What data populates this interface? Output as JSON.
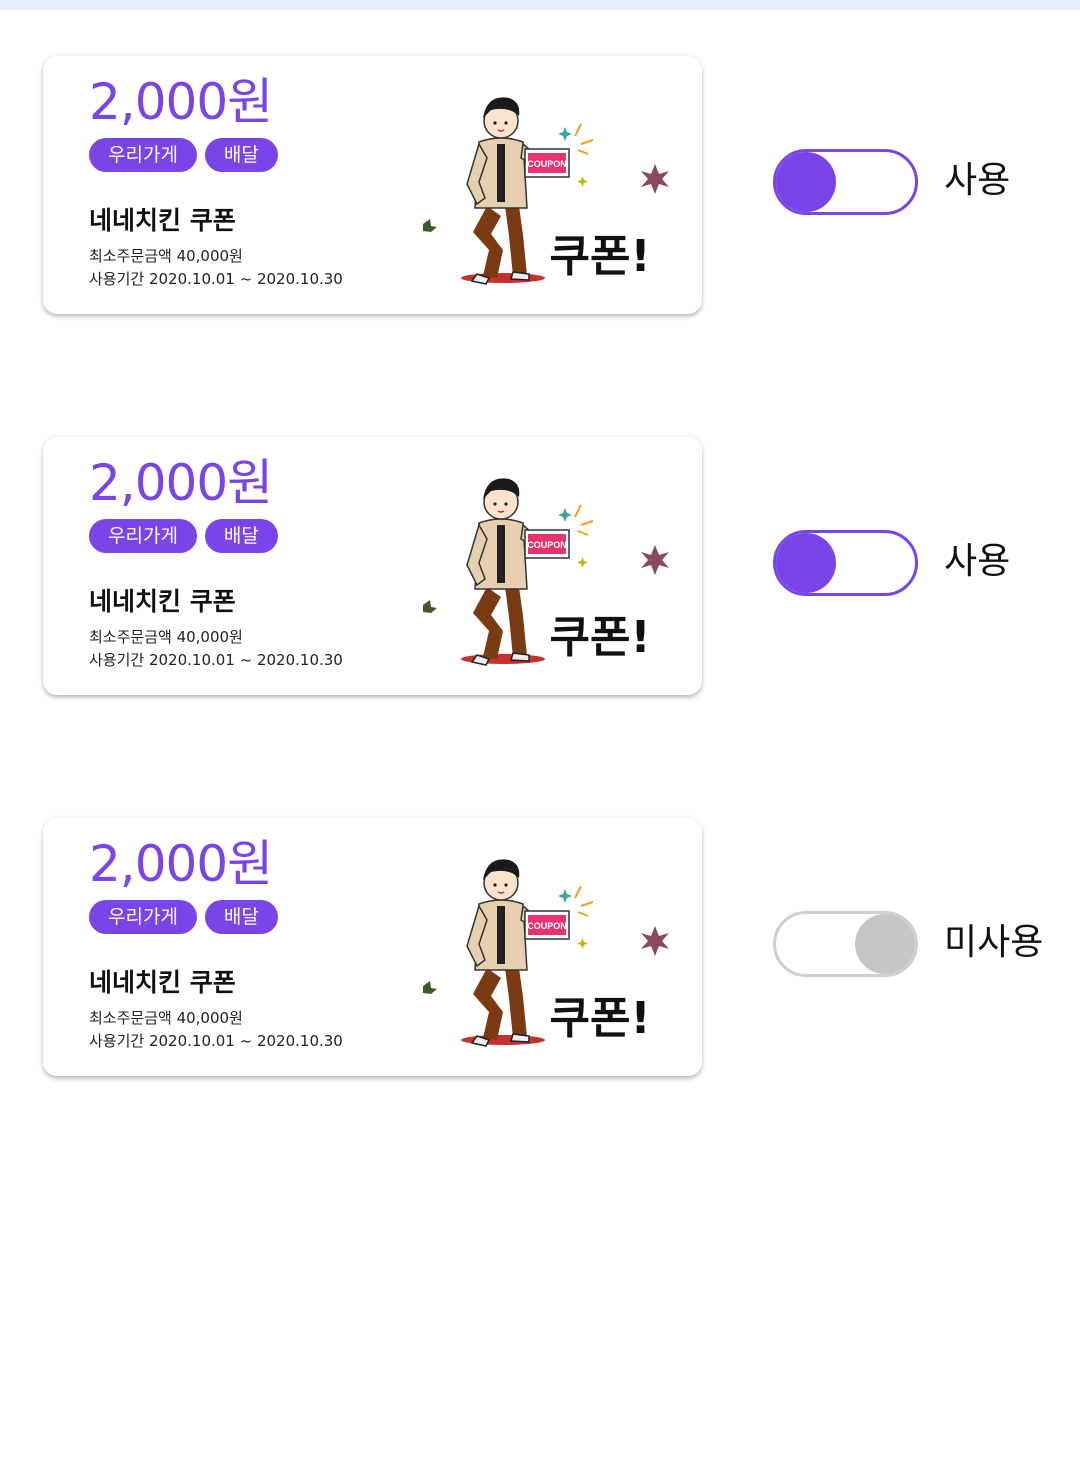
{
  "colors": {
    "accent": "#7a45e8",
    "toggle_off": "#c6c6c6",
    "coupon_red": "#e8336e"
  },
  "coupons": [
    {
      "amount": "2,000원",
      "tags": [
        "우리가게",
        "배달"
      ],
      "store_name": "네네치킨 쿠폰",
      "min_order": "최소주문금액 40,000원",
      "period": "사용기간 2020.10.01 ~ 2020.10.30",
      "illustration": {
        "ticket_text": "COUPON",
        "headline": "쿠폰!"
      },
      "toggle_on": true,
      "state_label": "사용"
    },
    {
      "amount": "2,000원",
      "tags": [
        "우리가게",
        "배달"
      ],
      "store_name": "네네치킨 쿠폰",
      "min_order": "최소주문금액 40,000원",
      "period": "사용기간 2020.10.01 ~ 2020.10.30",
      "illustration": {
        "ticket_text": "COUPON",
        "headline": "쿠폰!"
      },
      "toggle_on": true,
      "state_label": "사용"
    },
    {
      "amount": "2,000원",
      "tags": [
        "우리가게",
        "배달"
      ],
      "store_name": "네네치킨 쿠폰",
      "min_order": "최소주문금액 40,000원",
      "period": "사용기간 2020.10.01 ~ 2020.10.30",
      "illustration": {
        "ticket_text": "COUPON",
        "headline": "쿠폰!"
      },
      "toggle_on": false,
      "state_label": "미사용"
    }
  ]
}
